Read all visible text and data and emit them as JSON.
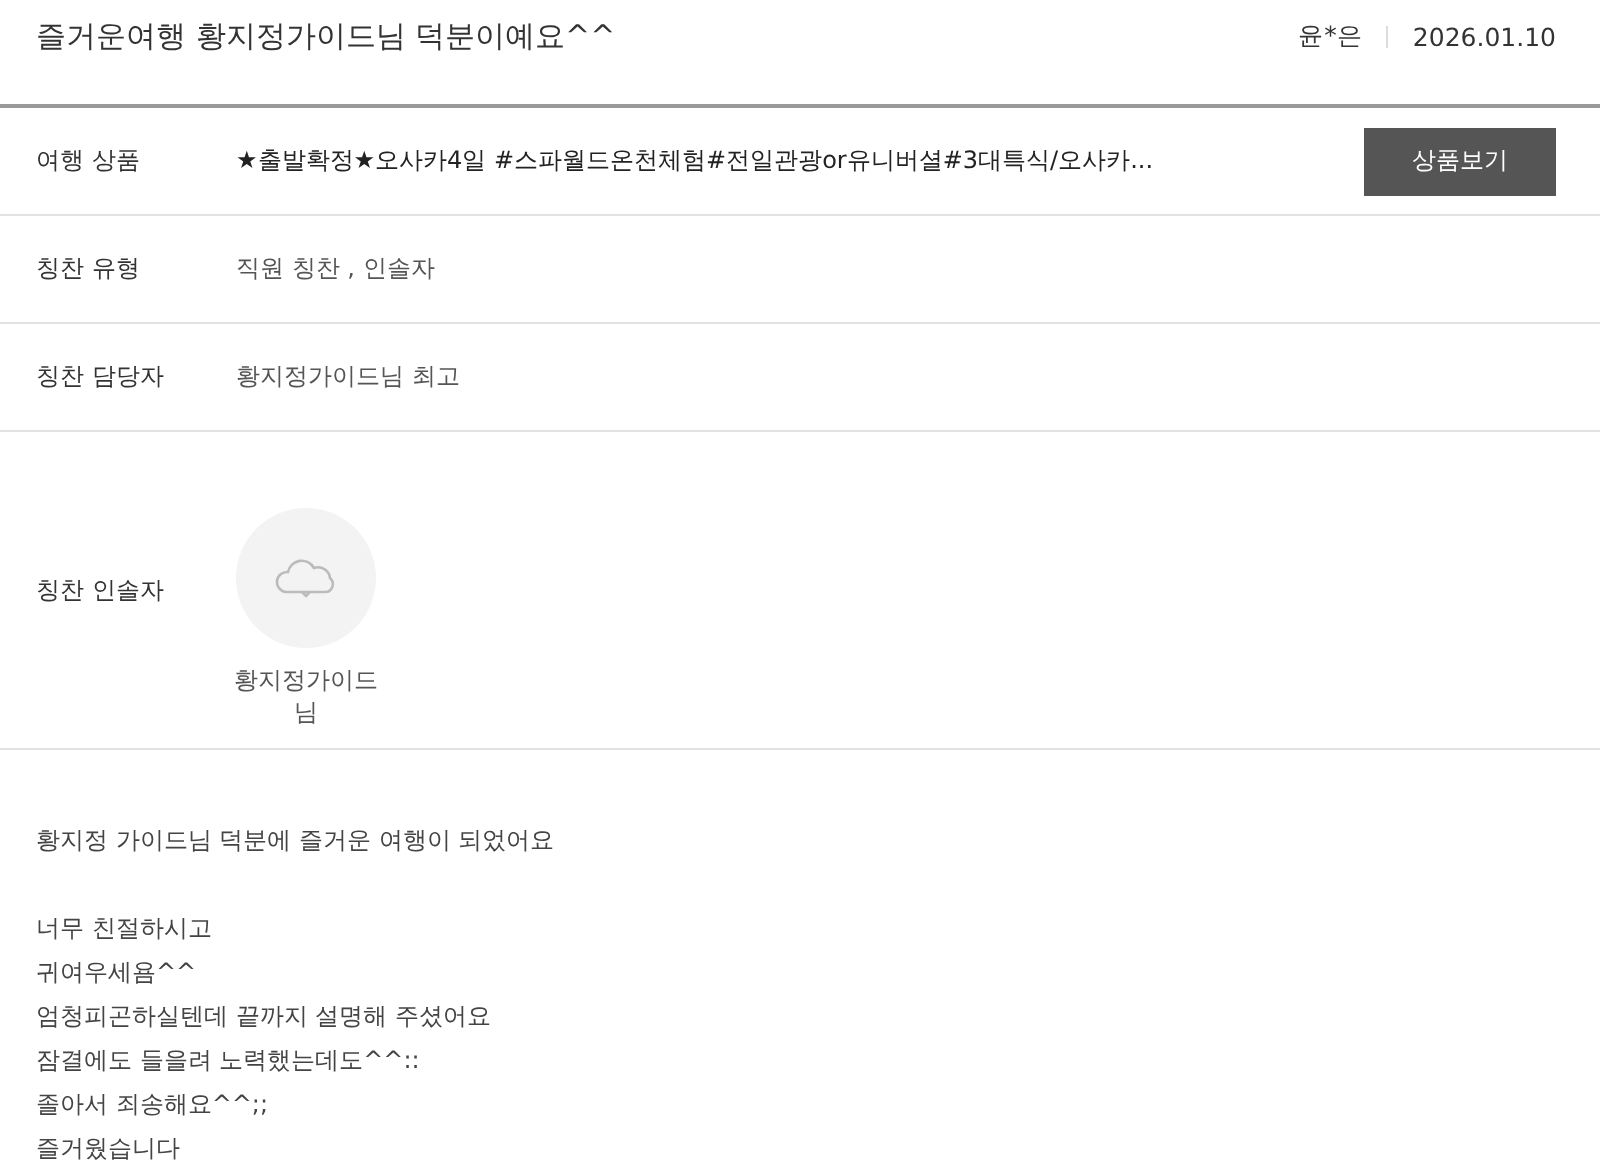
{
  "review": {
    "title": "즐거운여행 황지정가이드님 덕분이예요^^",
    "author": "윤*은",
    "date": "2026.01.10"
  },
  "fields": [
    {
      "kind": "product",
      "label": "여행 상품",
      "value": "★출발확정★오사카4일 #스파월드온천체험#전일관광or유니버셜#3대특식/오사카...",
      "button": "상품보기"
    },
    {
      "kind": "text",
      "label": "칭찬 유형",
      "value": "직원 칭찬 , 인솔자"
    },
    {
      "kind": "text",
      "label": "칭찬 담당자",
      "value": "황지정가이드님 최고"
    },
    {
      "kind": "person",
      "label": "칭찬 인솔자",
      "value": "황지정가이드님"
    }
  ],
  "body": [
    [
      "황지정 가이드님 덕분에 즐거운 여행이 되었어요"
    ],
    [
      "너무 친절하시고",
      "귀여우세욤^^",
      "엄청피곤하실텐데 끝까지 설명해 주셨어요",
      "잠결에도 들을려 노력했는데도^^::",
      "졸아서 죄송해요^^;;",
      "즐거웠습니다"
    ]
  ]
}
